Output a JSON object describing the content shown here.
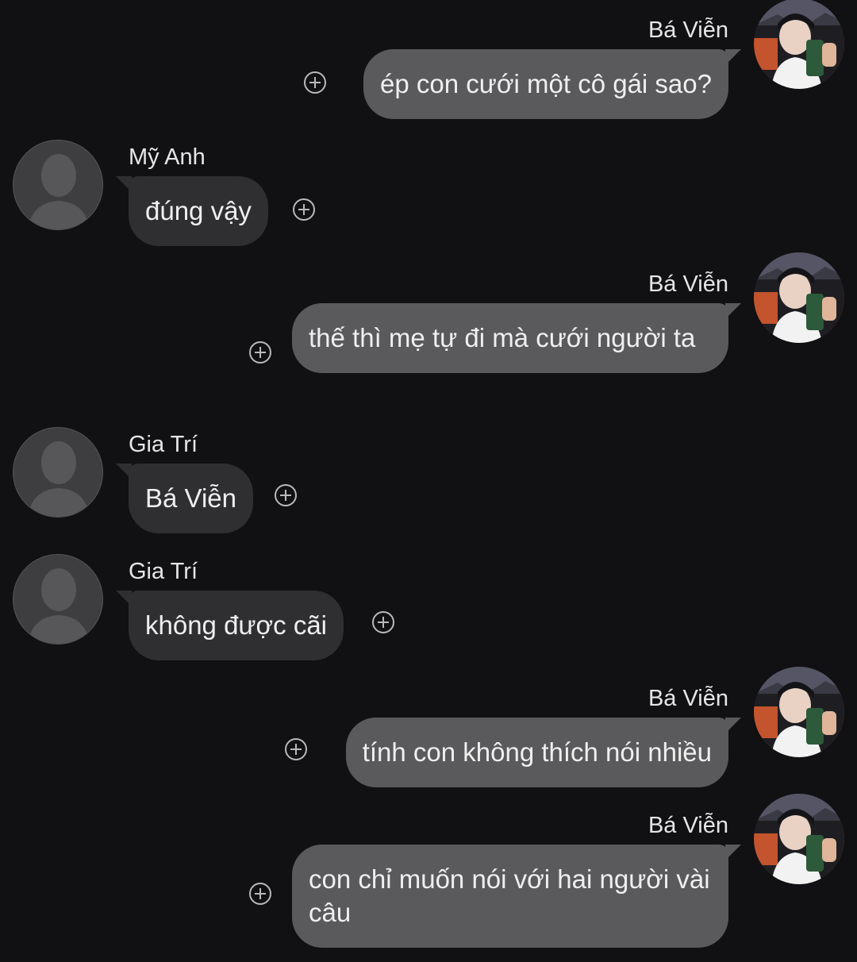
{
  "messages": [
    {
      "side": "right",
      "sender": "Bá Viễn",
      "text": "ép con cưới một cô gái sao?"
    },
    {
      "side": "left",
      "sender": "Mỹ Anh",
      "text": "đúng vậy"
    },
    {
      "side": "right",
      "sender": "Bá Viễn",
      "text": "thế thì mẹ tự đi mà cưới người ta"
    },
    {
      "side": "left",
      "sender": "Gia Trí",
      "text": "Bá Viễn"
    },
    {
      "side": "left",
      "sender": "Gia Trí",
      "text": "không được cãi"
    },
    {
      "side": "right",
      "sender": "Bá Viễn",
      "text": "tính con không thích nói nhiều"
    },
    {
      "side": "right",
      "sender": "Bá Viễn",
      "text": "con chỉ muốn nói với hai người vài câu"
    }
  ],
  "icons": {
    "reaction_icon": "plus-circle-icon",
    "default_avatar": "person-silhouette-icon"
  },
  "colors": {
    "background": "#111012",
    "outgoing_bubble": "#5a595b",
    "incoming_bubble": "#2f2e31",
    "text": "#efefef"
  }
}
